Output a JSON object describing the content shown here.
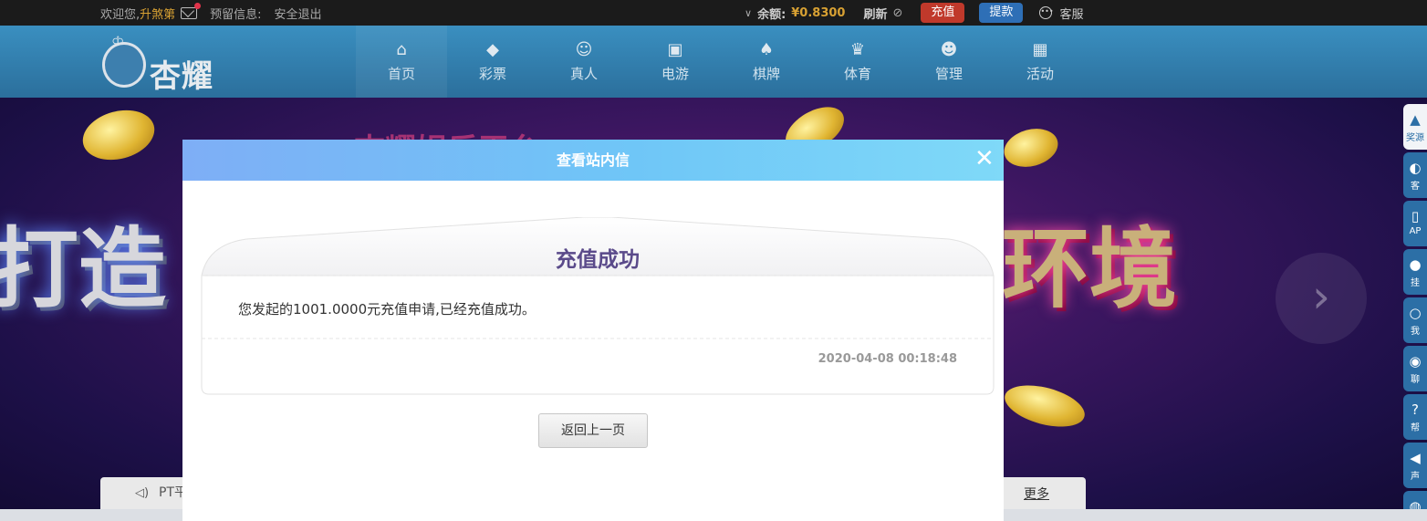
{
  "topbar": {
    "welcome": "欢迎您,",
    "username": "升煞第",
    "reserve_label": "预留信息:",
    "logout": "安全退出",
    "balance_label": "余额:",
    "balance_value": "¥0.8300",
    "refresh": "刷新",
    "recharge": "充值",
    "withdraw": "提款",
    "customer_service": "客服"
  },
  "brand": {
    "name": "杏耀"
  },
  "nav": {
    "items": [
      {
        "label": "首页",
        "icon": "home-icon",
        "glyph": "⌂"
      },
      {
        "label": "彩票",
        "icon": "ticket-icon",
        "glyph": "◆"
      },
      {
        "label": "真人",
        "icon": "person-icon",
        "glyph": "☺"
      },
      {
        "label": "电游",
        "icon": "slot-machine-icon",
        "glyph": "▣"
      },
      {
        "label": "棋牌",
        "icon": "cards-icon",
        "glyph": "♠"
      },
      {
        "label": "体育",
        "icon": "trophy-icon",
        "glyph": "♛"
      },
      {
        "label": "管理",
        "icon": "users-icon",
        "glyph": "☻"
      },
      {
        "label": "活动",
        "icon": "gift-icon",
        "glyph": "▦"
      }
    ]
  },
  "banner": {
    "top_text": "杏耀娱乐平台",
    "left_text": "打造",
    "right_text": "环境"
  },
  "notice": {
    "text": "PT平",
    "more": "更多"
  },
  "sidebar": {
    "items": [
      {
        "label": "奖源",
        "icon": "award-icon",
        "glyph": "▲"
      },
      {
        "label": "客",
        "icon": "headset-icon",
        "glyph": "◐"
      },
      {
        "label": "AP",
        "icon": "phone-icon",
        "glyph": "▯"
      },
      {
        "label": "挂",
        "icon": "user-icon",
        "glyph": "●"
      },
      {
        "label": "我",
        "icon": "profile-icon",
        "glyph": "○"
      },
      {
        "label": "聊",
        "icon": "chat-icon",
        "glyph": "◉"
      },
      {
        "label": "帮",
        "icon": "help-icon",
        "glyph": "?"
      },
      {
        "label": "声",
        "icon": "sound-icon",
        "glyph": "◀"
      },
      {
        "label": "",
        "icon": "globe-icon",
        "glyph": "◍"
      }
    ]
  },
  "modal": {
    "title": "查看站内信",
    "message_title": "充值成功",
    "message_body": "您发起的1001.0000元充值申请,已经充值成功。",
    "timestamp": "2020-04-08 00:18:48",
    "back_button": "返回上一页"
  }
}
